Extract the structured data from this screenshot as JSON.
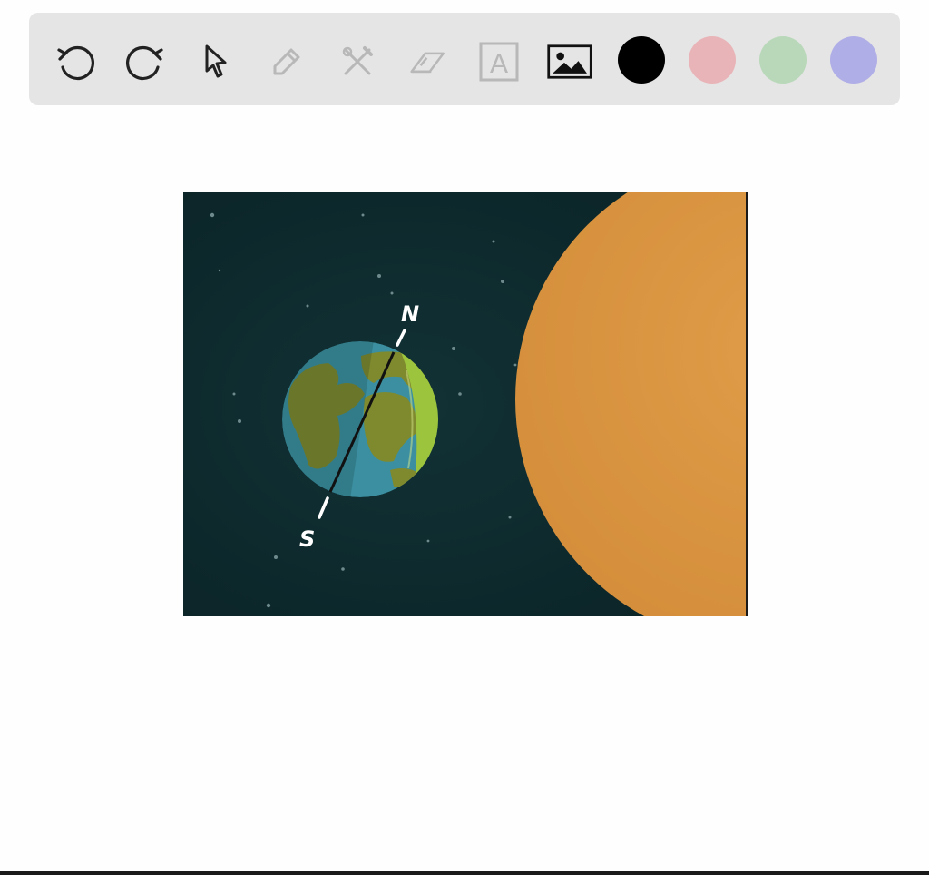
{
  "toolbar": {
    "tools": [
      {
        "name": "undo-icon",
        "state": "enabled"
      },
      {
        "name": "redo-icon",
        "state": "enabled"
      },
      {
        "name": "pointer-icon",
        "state": "enabled"
      },
      {
        "name": "pen-icon",
        "state": "disabled"
      },
      {
        "name": "tools-icon",
        "state": "disabled"
      },
      {
        "name": "eraser-icon",
        "state": "disabled"
      },
      {
        "name": "text-icon",
        "state": "disabled"
      },
      {
        "name": "image-icon",
        "state": "enabled"
      }
    ],
    "text_tool_glyph": "A",
    "colors": [
      "#000000",
      "#e8b4b8",
      "#b9d8b9",
      "#b0aee6"
    ]
  },
  "canvas": {
    "image": {
      "name": "earth-sun-illustration",
      "north_label": "N",
      "south_label": "S",
      "colors": {
        "space": "#0e2a2d",
        "sun": "#dc9a44",
        "ocean": "#3b8fa0",
        "land": "#7f8a2e",
        "lit_edge": "#9cc43c"
      }
    }
  }
}
